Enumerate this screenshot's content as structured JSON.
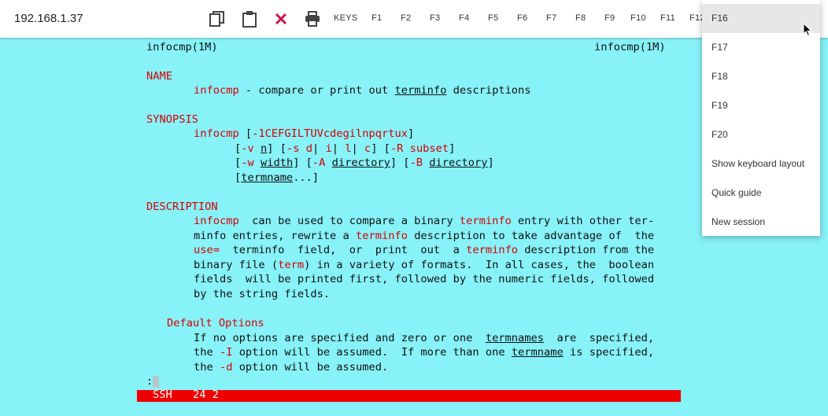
{
  "toolbar": {
    "host": "192.168.1.37",
    "icons": [
      "copy-icon",
      "clipboard-icon",
      "close-icon",
      "print-icon"
    ],
    "keys": [
      "KEYS",
      "F1",
      "F2",
      "F3",
      "F4",
      "F5",
      "F6",
      "F7",
      "F8",
      "F9",
      "F10",
      "F11",
      "F12"
    ]
  },
  "terminal": {
    "header_left": "infocmp(1M)",
    "header_right": "infocmp(1M)",
    "name_heading": "NAME",
    "name_cmd": "infocmp",
    "name_text1": " - compare or print out ",
    "name_term": "terminfo",
    "name_text2": " descriptions",
    "synopsis_heading": "SYNOPSIS",
    "syn1_cmd": "infocmp",
    "syn1_open": " [",
    "syn1_opts": "-1CEFGILTUVcdegilnpqrtux",
    "syn1_close": "]",
    "syn2_a": "[",
    "syn2_v": "-v",
    "syn2_n": "n",
    "syn2_b": "] [",
    "syn2_s": "-s",
    "syn2_d": "d",
    "syn2_p1": "|",
    "syn2_i": "i",
    "syn2_p2": "|",
    "syn2_l": "l",
    "syn2_p3": "|",
    "syn2_c": "c",
    "syn2_c2": "] [",
    "syn2_R": "-R",
    "syn2_subset": "subset",
    "syn2_end": "]",
    "syn3_a": "[",
    "syn3_w": "-w",
    "syn3_width": "width",
    "syn3_b": "] [",
    "syn3_A": "-A",
    "syn3_dir1": "directory",
    "syn3_c": "] [",
    "syn3_B": "-B",
    "syn3_dir2": "directory",
    "syn3_end": "]",
    "syn4_a": "[",
    "syn4_termname": "termname",
    "syn4_end": "...]",
    "description_heading": "DESCRIPTION",
    "d1_cmd": "infocmp",
    "d1_t1": "  can be used to compare a binary ",
    "d1_term": "terminfo",
    "d1_t2": " entry with other ter-",
    "d2_t1": "minfo entries, rewrite a ",
    "d2_term": "terminfo",
    "d2_t2": " description to take advantage of  the",
    "d3_use": "use=",
    "d3_t1": "  terminfo  field,  or  print  out  a ",
    "d3_term": "terminfo",
    "d3_t2": " description from the",
    "d4_t1": "binary file (",
    "d4_term": "term",
    "d4_t2": ") in a variety of formats.  In all cases, the  boolean",
    "d5": "fields  will be printed first, followed by the numeric fields, followed",
    "d6": "by the string fields.",
    "default_heading": "Default Options",
    "o1_t1": "If no options are specified and zero or one  ",
    "o1_termnames": "termnames",
    "o1_t2": "  are  specified,",
    "o2_t1": "the ",
    "o2_I": "-I",
    "o2_t2": " option will be assumed.  If more than one ",
    "o2_termname": "termname",
    "o2_t3": " is specified,",
    "o3_t1": "the ",
    "o3_d": "-d",
    "o3_t2": " option will be assumed.",
    "prompt": ":",
    "status_left": "SSH",
    "status_right": "24 2"
  },
  "menu": {
    "items": [
      "F16",
      "F17",
      "F18",
      "F19",
      "F20",
      "Show keyboard layout",
      "Quick guide",
      "New session"
    ]
  }
}
